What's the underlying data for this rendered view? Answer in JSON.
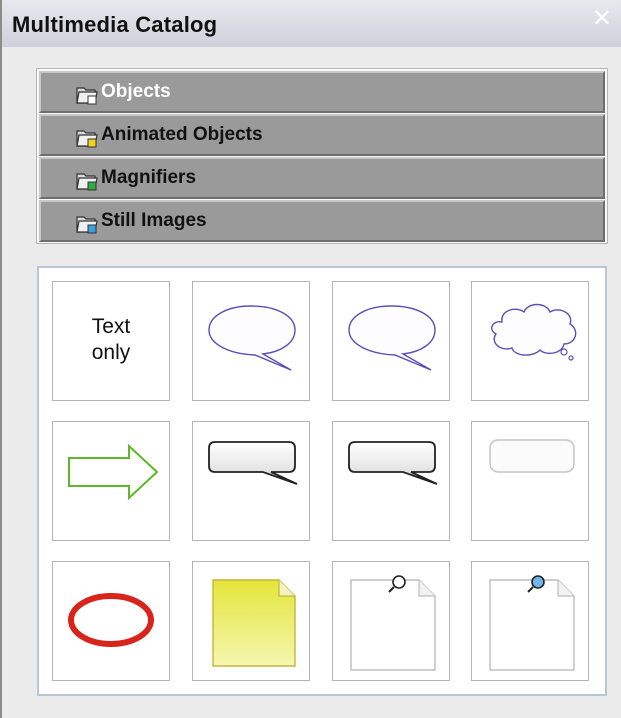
{
  "window": {
    "title": "Multimedia Catalog",
    "close_icon": "close-icon"
  },
  "categories": [
    {
      "label": "Objects",
      "active": true,
      "badge_color": "#ffffff"
    },
    {
      "label": "Animated Objects",
      "active": false,
      "badge_color": "#f2d21b"
    },
    {
      "label": "Magnifiers",
      "active": false,
      "badge_color": "#2fae3f"
    },
    {
      "label": "Still Images",
      "active": false,
      "badge_color": "#3aa0e0"
    }
  ],
  "objects": [
    {
      "name": "text-only-item",
      "label_line1": "Text",
      "label_line2": "only"
    },
    {
      "name": "speech-bubble-oval-item",
      "icon": "speech-bubble-oval-icon"
    },
    {
      "name": "speech-bubble-oval-2-item",
      "icon": "speech-bubble-oval-icon"
    },
    {
      "name": "thought-bubble-item",
      "icon": "thought-bubble-icon"
    },
    {
      "name": "arrow-item",
      "icon": "arrow-icon"
    },
    {
      "name": "rect-callout-item",
      "icon": "rect-callout-icon"
    },
    {
      "name": "rect-callout-2-item",
      "icon": "rect-callout-icon"
    },
    {
      "name": "rounded-rect-item",
      "icon": "rounded-rect-icon"
    },
    {
      "name": "circle-highlight-item",
      "icon": "circle-highlight-icon"
    },
    {
      "name": "sticky-note-item",
      "icon": "sticky-note-icon"
    },
    {
      "name": "page-magnifier-item",
      "icon": "page-magnifier-icon"
    },
    {
      "name": "page-magnifier-blue-item",
      "icon": "page-magnifier-blue-icon"
    }
  ],
  "colors": {
    "category_bg": "#9a9a9a",
    "callout_stroke": "#5a4fb8",
    "arrow_stroke": "#5fb62a",
    "circle_red": "#d8241a",
    "sticky_yellow": "#e9ec5a",
    "magnifier_blue": "#6fb4ea"
  }
}
